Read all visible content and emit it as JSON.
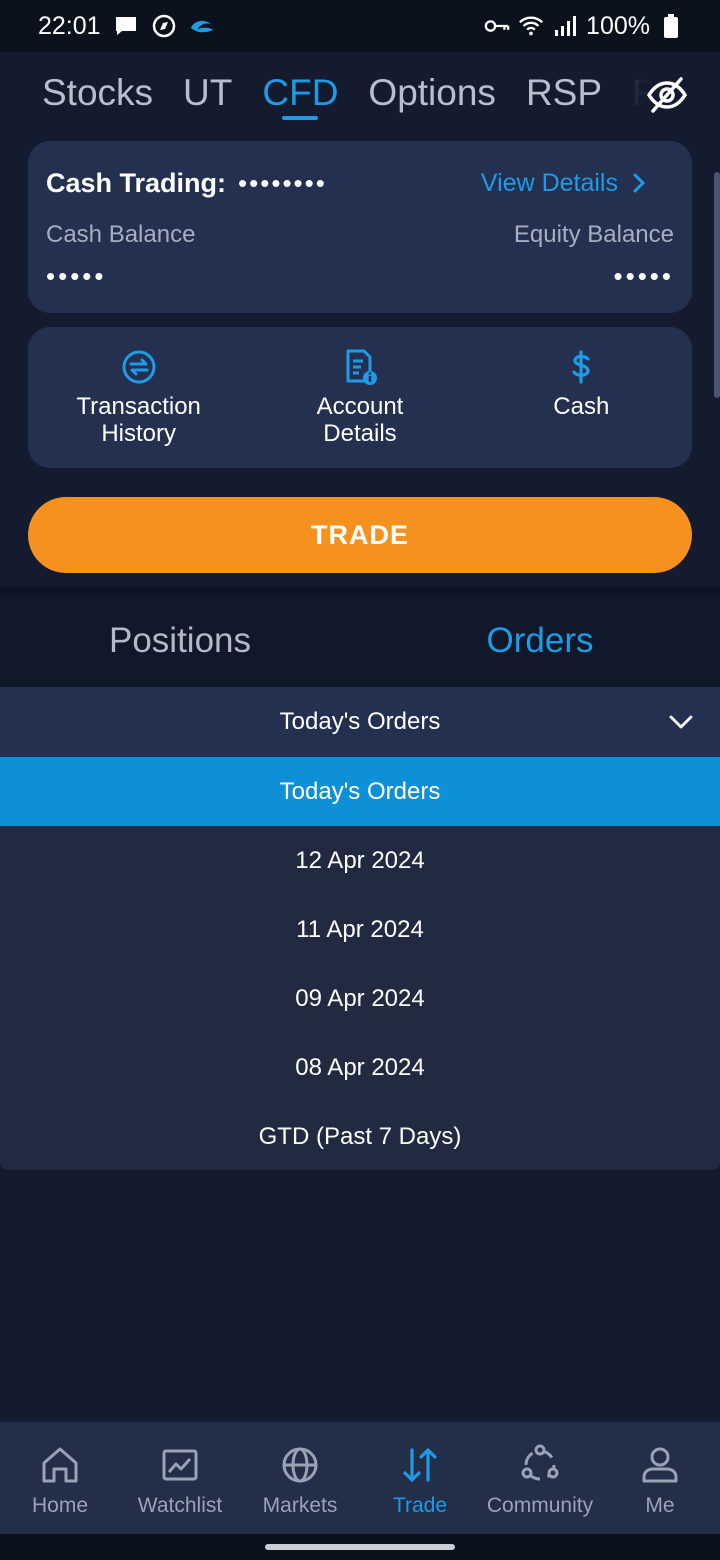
{
  "status_bar": {
    "time": "22:01",
    "battery": "100%"
  },
  "top_tabs": [
    {
      "label": "Stocks"
    },
    {
      "label": "UT"
    },
    {
      "label": "CFD"
    },
    {
      "label": "Options"
    },
    {
      "label": "RSP"
    },
    {
      "label": "F"
    }
  ],
  "account": {
    "title": "Cash Trading:",
    "masked_id": "••••••••",
    "view_details": "View Details",
    "cash_balance_label": "Cash Balance",
    "equity_balance_label": "Equity Balance",
    "cash_balance_value": "•••••",
    "equity_balance_value": "•••••"
  },
  "actions": [
    {
      "label": "Transaction History",
      "icon": "transaction-history-icon"
    },
    {
      "label": "Account Details",
      "icon": "account-details-icon"
    },
    {
      "label": "Cash",
      "icon": "dollar-icon"
    }
  ],
  "trade_button": "TRADE",
  "sub_tabs": {
    "positions": "Positions",
    "orders": "Orders"
  },
  "orders_filter": {
    "selected": "Today's Orders",
    "options": [
      "Today's Orders",
      "12 Apr 2024",
      "11 Apr 2024",
      "09 Apr 2024",
      "08 Apr 2024",
      "GTD (Past 7 Days)"
    ]
  },
  "bottom_nav": [
    {
      "label": "Home",
      "icon": "home-icon"
    },
    {
      "label": "Watchlist",
      "icon": "watchlist-icon"
    },
    {
      "label": "Markets",
      "icon": "globe-icon"
    },
    {
      "label": "Trade",
      "icon": "trade-arrows-icon"
    },
    {
      "label": "Community",
      "icon": "community-icon"
    },
    {
      "label": "Me",
      "icon": "person-icon"
    }
  ],
  "colors": {
    "accent": "#1f9be6",
    "trade_button": "#f5911e",
    "background": "#141b2e",
    "card": "#243050"
  }
}
